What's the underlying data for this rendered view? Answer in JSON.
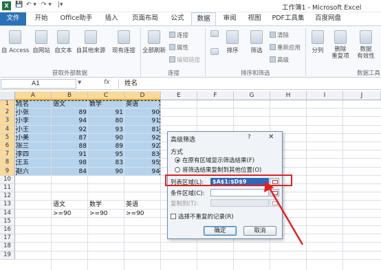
{
  "titlebar": {
    "title": "工作簿1 - Microsoft Excel",
    "app_icon": "X",
    "quick_access": [
      "💾",
      "↶ ▾",
      "↷ ▾",
      "|▾"
    ]
  },
  "tabs": [
    {
      "label": "文件",
      "kind": "file"
    },
    {
      "label": "开始"
    },
    {
      "label": "Office助手"
    },
    {
      "label": "插入"
    },
    {
      "label": "页面布局"
    },
    {
      "label": "公式"
    },
    {
      "label": "数据",
      "active": true
    },
    {
      "label": "审阅"
    },
    {
      "label": "视图"
    },
    {
      "label": "PDF工具集"
    },
    {
      "label": "百度网盘"
    }
  ],
  "ribbon": {
    "buttons": [
      "自 Access",
      "自网站",
      "自文本",
      "自其他来源",
      "现有连接",
      "全部刷新",
      "排序",
      "筛选",
      "分列",
      "删除\n重复项",
      "数据\n有效性"
    ],
    "small": [
      "连接",
      "属性",
      "编辑链接",
      "清除",
      "重新应用",
      "高级"
    ],
    "groups": [
      "获取外部数据",
      "连接",
      "排序和筛选",
      "数据工具"
    ]
  },
  "formula_bar": {
    "name_box": "A1",
    "fx": "fx",
    "formula": "姓名"
  },
  "grid": {
    "columns": [
      "A",
      "B",
      "C",
      "D",
      "E",
      "F",
      "G",
      "H",
      "I",
      "J"
    ],
    "rows": [
      "1",
      "2",
      "3",
      "4",
      "5",
      "6",
      "7",
      "8",
      "9",
      "10",
      "11",
      "12",
      "13",
      "14",
      "15",
      "16",
      "17",
      "18",
      "19"
    ],
    "data_rows": [
      [
        "姓名",
        "语文",
        "数学",
        "英语"
      ],
      [
        "小张",
        "89",
        "91",
        "90"
      ],
      [
        "小李",
        "94",
        "80",
        "91"
      ],
      [
        "小王",
        "92",
        "93",
        "81"
      ],
      [
        "小美",
        "87",
        "90",
        "92"
      ],
      [
        "张三",
        "88",
        "89",
        "92"
      ],
      [
        "李四",
        "91",
        "95",
        "83"
      ],
      [
        "王五",
        "98",
        "83",
        "95"
      ],
      [
        "赵六",
        "84",
        "90",
        "94"
      ]
    ],
    "criteria": [
      [
        "语文",
        "数学",
        "英语"
      ],
      [
        ">=90",
        ">=90",
        ">=90"
      ]
    ]
  },
  "dialog": {
    "title": "高级筛选",
    "help": "?",
    "close": "✕",
    "method_label": "方式",
    "option_inplace": "在原有区域显示筛选结果(F)",
    "option_copy": "将筛选结果复制到其他位置(O)",
    "list_range_label": "列表区域(L):",
    "list_range_value": "$A$1:$D$9",
    "criteria_range_label": "条件区域(C):",
    "criteria_range_value": "",
    "copy_to_label": "复制到(T):",
    "copy_to_value": "",
    "unique_label": "选择不重复的记录(R)",
    "ok": "确定",
    "cancel": "取消"
  },
  "colors": {
    "accent": "#2c72b7",
    "selection": "#b6d3ee",
    "annotation": "#e02020",
    "excel_green": "#1f7244"
  }
}
